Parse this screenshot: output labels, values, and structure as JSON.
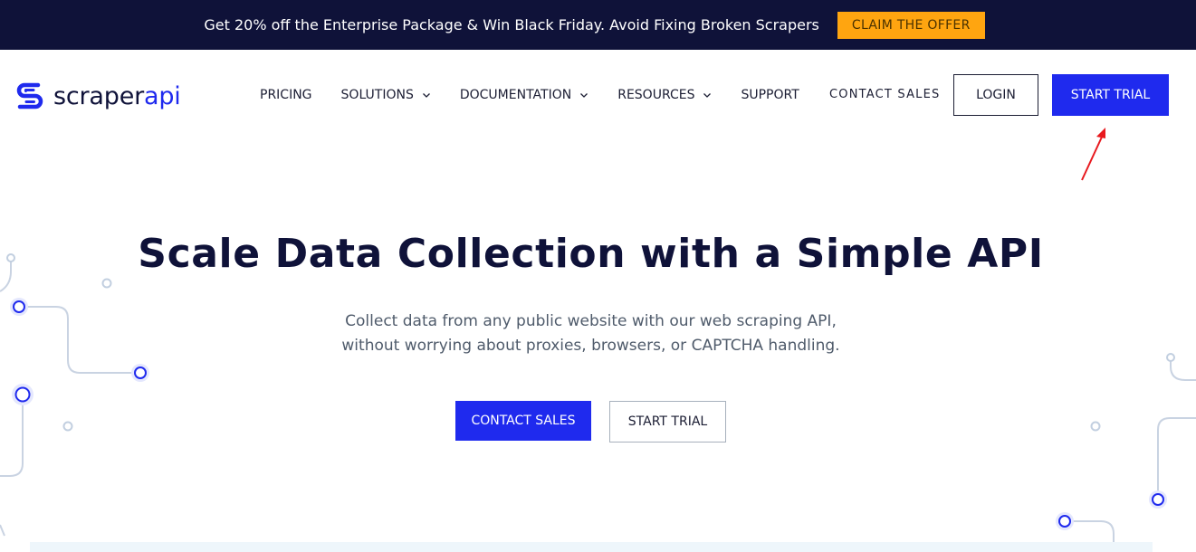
{
  "promo": {
    "text": "Get 20% off the Enterprise Package & Win Black Friday. Avoid Fixing Broken Scrapers",
    "cta": "CLAIM THE OFFER"
  },
  "brand": {
    "name_part1": "scraper",
    "name_part2": "api",
    "icon": "scraperapi-logo-icon"
  },
  "nav": {
    "items": [
      {
        "label": "PRICING",
        "has_dropdown": false
      },
      {
        "label": "SOLUTIONS",
        "has_dropdown": true
      },
      {
        "label": "DOCUMENTATION",
        "has_dropdown": true
      },
      {
        "label": "RESOURCES",
        "has_dropdown": true
      },
      {
        "label": "SUPPORT",
        "has_dropdown": false
      }
    ],
    "contact_sales": "CONTACT SALES",
    "login": "LOGIN",
    "start_trial": "START TRIAL"
  },
  "hero": {
    "title": "Scale Data Collection with a Simple API",
    "subtitle_line1": "Collect data from any public website with our web scraping API,",
    "subtitle_line2": "without worrying about proxies, browsers, or CAPTCHA handling.",
    "cta_primary": "CONTACT SALES",
    "cta_secondary": "START TRIAL"
  },
  "colors": {
    "primary": "#1f2aee",
    "promo_bg": "#0f1239",
    "promo_button": "#ffa510",
    "heading": "#0f1239",
    "annotation_arrow": "#e8191e"
  }
}
